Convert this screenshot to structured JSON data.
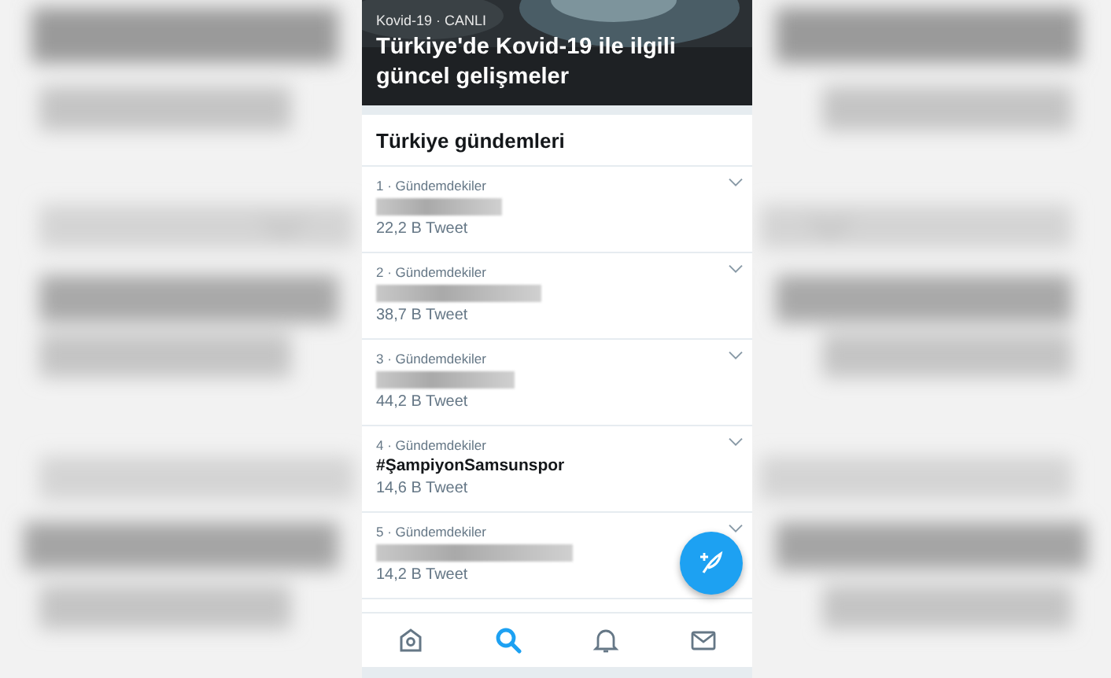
{
  "header": {
    "meta": "Kovid-19 · CANLI",
    "title": "Türkiye'de Kovid-19 ile ilgili güncel gelişmeler",
    "kind": "picture"
  },
  "section_title": "Türkiye gündemleri",
  "trends": [
    {
      "rank": "1 · Gündemdekiler",
      "kind": "redacted",
      "count": "22,2 B Tweet"
    },
    {
      "rank": "2 · Gündemdekiler",
      "kind": "redacted",
      "count": "38,7 B Tweet"
    },
    {
      "rank": "3 · Gündemdekiler",
      "kind": "redacted",
      "count": "44,2 B Tweet"
    },
    {
      "rank": "4 · Gündemdekiler",
      "kind": "text",
      "name": "#ŞampiyonSamsunspor",
      "count": "14,6 B Tweet"
    },
    {
      "rank": "5 · Gündemdekiler",
      "kind": "redacted",
      "count": "14,2 B Tweet"
    }
  ],
  "nav": [
    {
      "kind": "home",
      "selected": false
    },
    {
      "kind": "search",
      "selected": true
    },
    {
      "kind": "notifications",
      "selected": false
    },
    {
      "kind": "messages",
      "selected": false
    }
  ]
}
